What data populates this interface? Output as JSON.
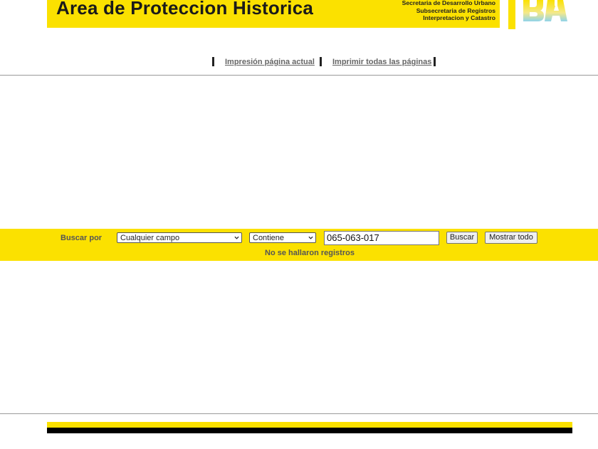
{
  "header": {
    "title": "Area de Proteccion Historica",
    "subtitle_lines": [
      "Secretaria de Desarrollo Urbano",
      "Subsecretaria de Registros",
      "Interpretacion y Catastro"
    ],
    "logo_text": "BA",
    "brand_color": "#fbe100"
  },
  "print_links": {
    "current_page": "Impresión página actual",
    "all_pages": "Imprimir todas las páginas"
  },
  "search": {
    "label": "Buscar por",
    "field_select": "Cualquier campo",
    "operator_select": "Contiene",
    "query_value": "065-063-017",
    "search_button": "Buscar",
    "show_all_button": "Mostrar todo",
    "message": "No se hallaron registros"
  },
  "icons": {
    "select_arrow": "chevron-down-icon",
    "logo": "ba-logo-icon"
  }
}
